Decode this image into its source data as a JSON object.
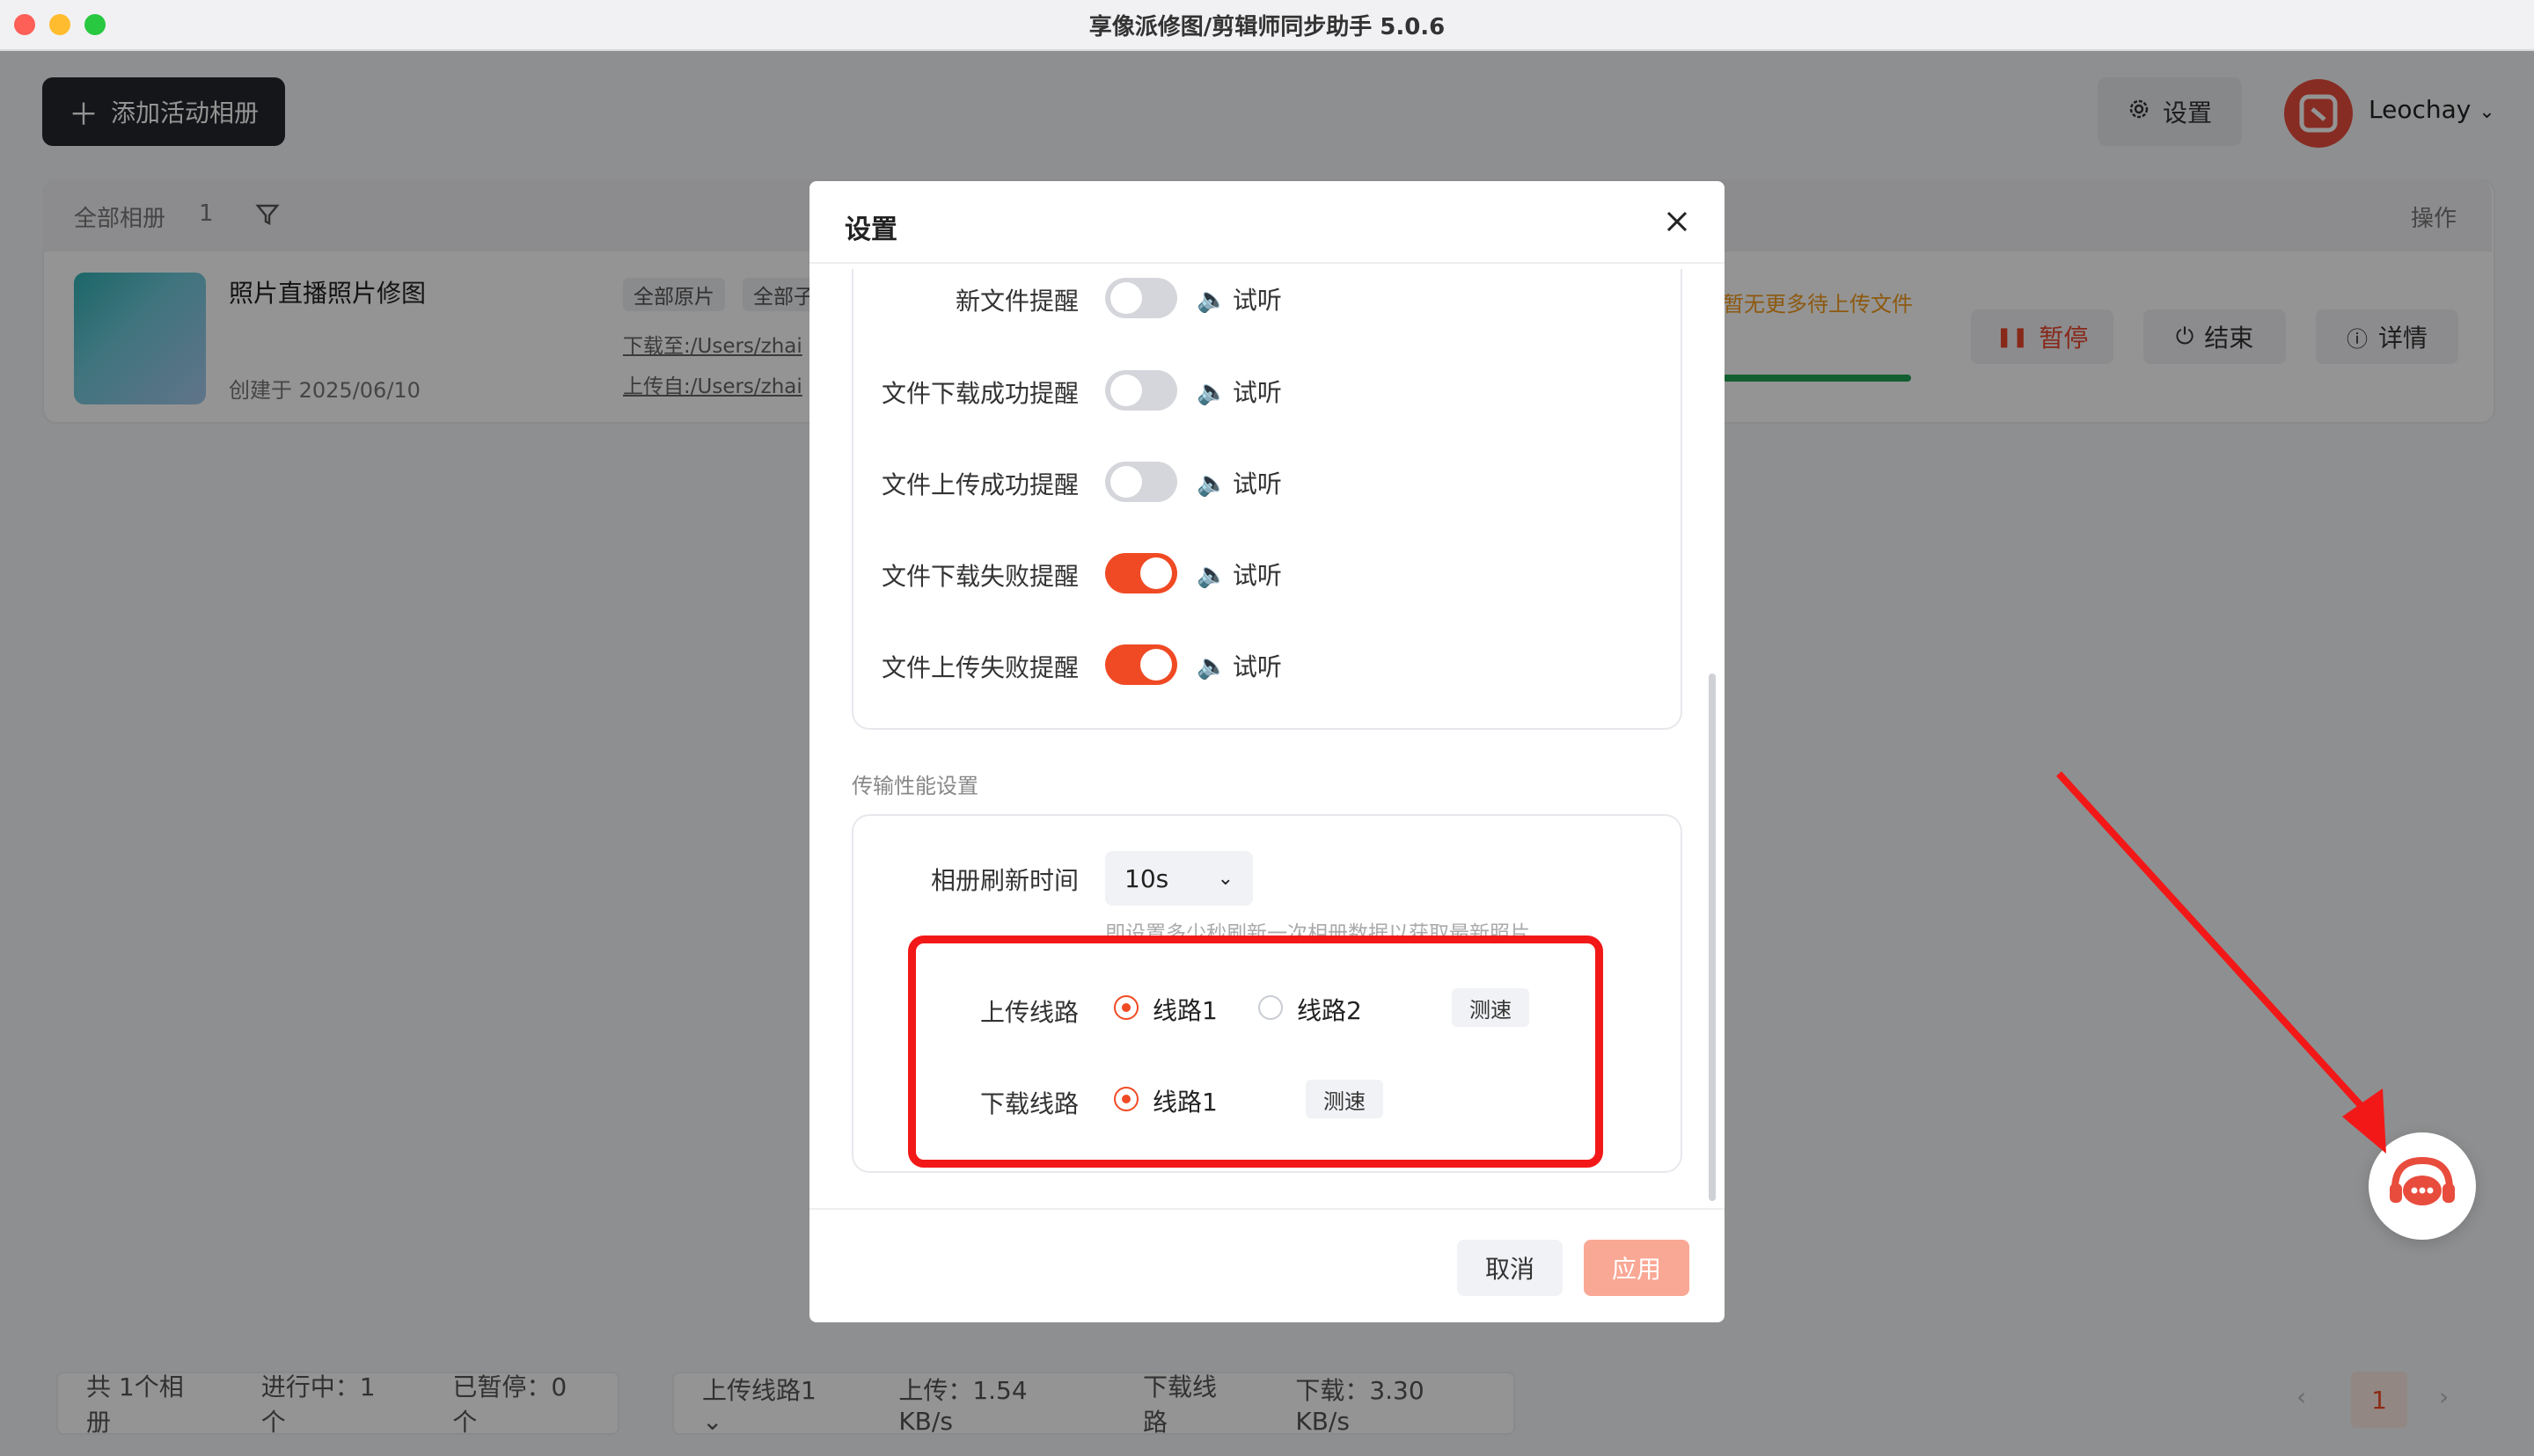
{
  "window": {
    "title": "享像派修图/剪辑师同步助手 5.0.6"
  },
  "header": {
    "add_album_label": "添加活动相册",
    "settings_label": "设置",
    "username": "Leochay"
  },
  "album_list": {
    "all_albums_label": "全部相册",
    "all_albums_count": "1",
    "operations_label": "操作",
    "album": {
      "name": "照片直播照片修图",
      "created": "创建于 2025/06/10",
      "tags": [
        "全部原片",
        "全部子"
      ],
      "download_path": "下载至:/Users/zhai",
      "upload_path": "上传自:/Users/zhai",
      "status_text": "暂无更多待上传文件",
      "pause_label": "暂停",
      "end_label": "结束",
      "detail_label": "详情"
    }
  },
  "status_bar": {
    "total": "共 1个相册",
    "running": "进行中：1个",
    "paused": "已暂停：0个",
    "upload_route": "上传线路1",
    "upload_speed": "上传：1.54 KB/s",
    "download_route": "下载线路",
    "download_speed": "下载：3.30 KB/s",
    "page": "1"
  },
  "settings_modal": {
    "title": "设置",
    "listen_label": "试听",
    "notifications": [
      {
        "label": "新文件提醒",
        "on": false
      },
      {
        "label": "文件下载成功提醒",
        "on": false
      },
      {
        "label": "文件上传成功提醒",
        "on": false
      },
      {
        "label": "文件下载失败提醒",
        "on": true
      },
      {
        "label": "文件上传失败提醒",
        "on": true
      }
    ],
    "perf_section_label": "传输性能设置",
    "refresh_label": "相册刷新时间",
    "refresh_value": "10s",
    "refresh_hint": "即设置多少秒刷新一次相册数据以获取最新照片",
    "upload_route_label": "上传线路",
    "upload_route_options": [
      "线路1",
      "线路2"
    ],
    "upload_route_selected": "线路1",
    "download_route_label": "下载线路",
    "download_route_options": [
      "线路1"
    ],
    "download_route_selected": "线路1",
    "speed_test_label": "测速",
    "cancel_label": "取消",
    "apply_label": "应用"
  },
  "colors": {
    "accent": "#f04a24",
    "highlight": "#f21818"
  }
}
